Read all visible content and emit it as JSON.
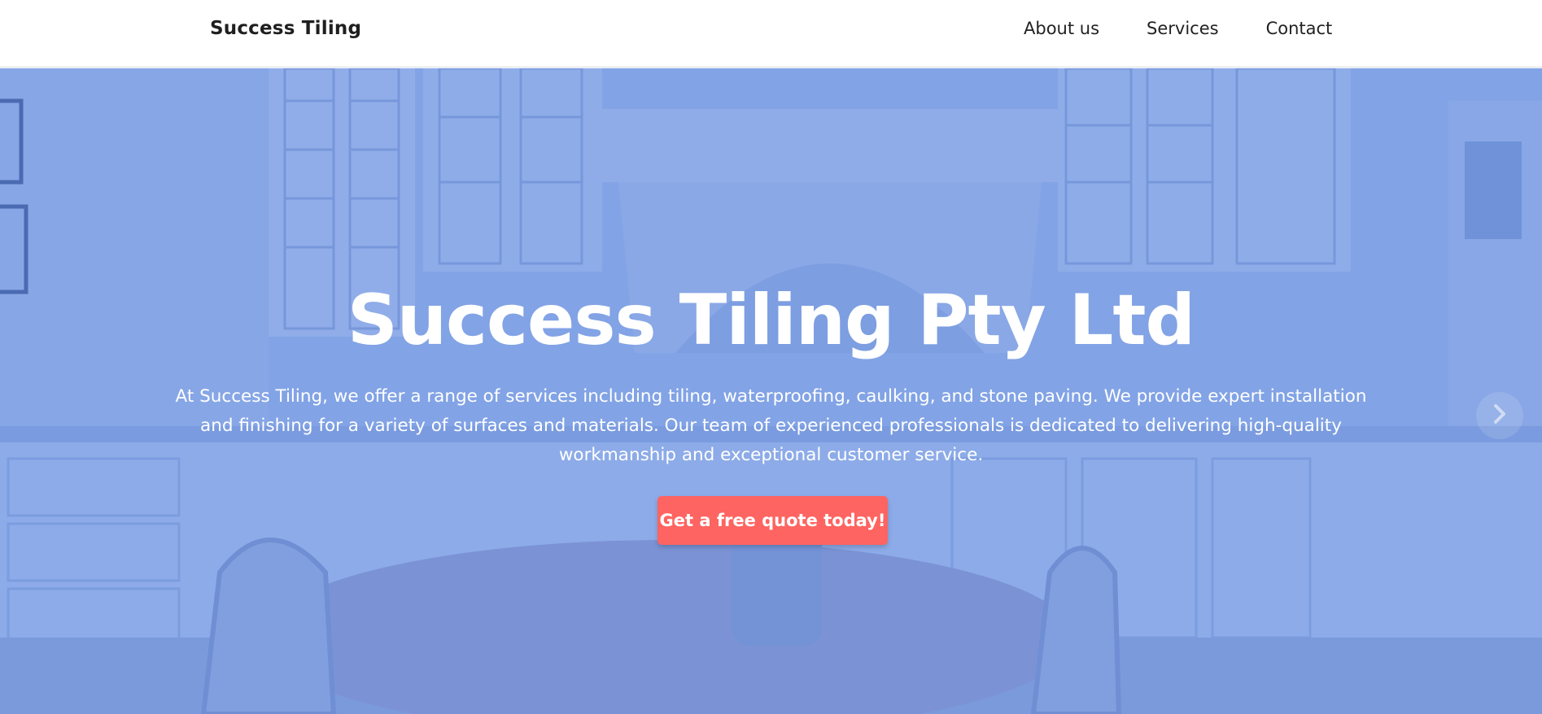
{
  "nav": {
    "brand": "Success Tiling",
    "links": [
      {
        "label": "About us"
      },
      {
        "label": "Services"
      },
      {
        "label": "Contact"
      }
    ]
  },
  "hero": {
    "title": "Success Tiling Pty Ltd",
    "description": "At Success Tiling, we offer a range of services including tiling, waterproofing, caulking, and stone paving. We provide expert installation and finishing for a variety of surfaces and materials. Our team of experienced professionals is dedicated to delivering high-quality workmanship and exceptional customer service.",
    "cta_label": "Get a free quote today!",
    "next_icon": "chevron-right-icon"
  },
  "colors": {
    "overlay": "#5683e2",
    "cta": "#fe6461",
    "text_light": "#ffffff",
    "text_dark": "#1f1f1f"
  }
}
